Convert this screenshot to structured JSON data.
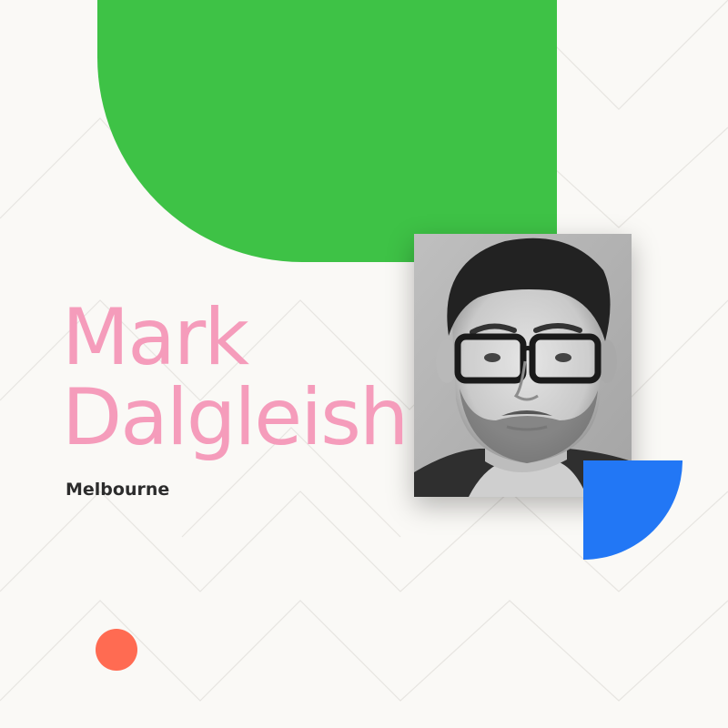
{
  "speaker": {
    "first_name": "Mark",
    "last_name": "Dalgleish",
    "location": "Melbourne",
    "photo_icon": "portrait-photo"
  },
  "colors": {
    "background": "#faf9f6",
    "green_shape": "#3ec246",
    "name_text": "#f59cbb",
    "location_text": "#2c2c2c",
    "blue_shape": "#2277f5",
    "orange_dot": "#ff6b52",
    "line_pattern": "#e7e5e1"
  }
}
